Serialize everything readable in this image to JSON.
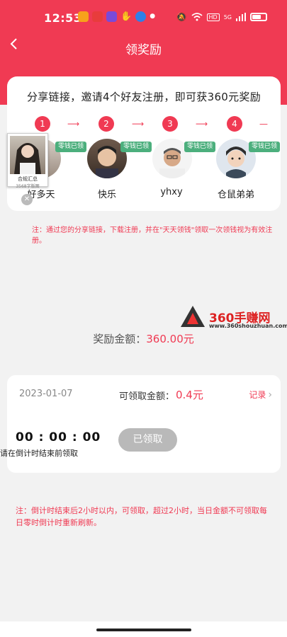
{
  "status": {
    "time": "12:53",
    "icons_left": [
      "notification-icon-1",
      "notification-icon-2",
      "notification-icon-3",
      "hand-icon",
      "app-icon",
      "dot"
    ],
    "icons_right": [
      "mute-icon",
      "wifi-icon",
      "hd-icon",
      "signal-icon",
      "battery-icon"
    ],
    "signal_text": "5G"
  },
  "header": {
    "title": "领奖励",
    "back_glyph": "<",
    "color": "#f03a53"
  },
  "invite": {
    "headline": "分享链接，邀请4个好友注册，即可获360元奖励",
    "steps": [
      "1",
      "2",
      "3",
      "4"
    ],
    "badge_label": "零钱已领",
    "friends": [
      {
        "name": "好多天"
      },
      {
        "name": "快乐"
      },
      {
        "name": "yhxy"
      },
      {
        "name": "仓鼠弟弟"
      }
    ]
  },
  "sticker": {
    "line1": "合规汇总",
    "line2": "3568字版图"
  },
  "note1": "注：通过您的分享链接，下载注册，并在\"天天领钱\"领取一次领钱视为有效注册。",
  "watermark": {
    "title": "360手赚网",
    "url": "www.360shouzhuan.com"
  },
  "reward": {
    "label": "奖励金额：",
    "value": "360.00元"
  },
  "claim": {
    "date": "2023-01-07",
    "label": "可领取金额：",
    "amount": "0.4元",
    "records_label": "记录",
    "countdown": "00 : 00 : 00",
    "countdown_note": "请在倒计时结束前领取",
    "claimed_label": "已领取"
  },
  "note2": "注：倒计时结束后2小时以内，可领取，超过2小时，当日金额不可领取每日零时倒计时重新刷新。"
}
